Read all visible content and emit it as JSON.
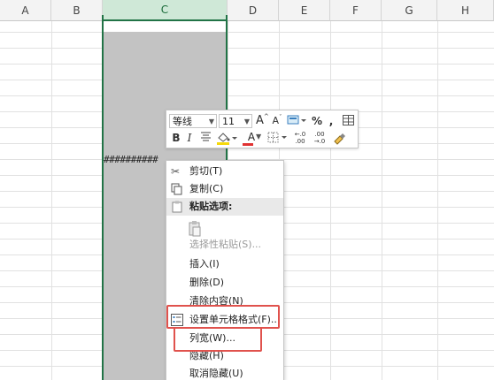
{
  "columns": [
    "A",
    "B",
    "C",
    "D",
    "E",
    "F",
    "G",
    "H"
  ],
  "selected_column": "C",
  "cell_overflow_text": "##########",
  "mini_toolbar": {
    "font_name": "等线",
    "font_size": "11",
    "increase_font": "A",
    "decrease_font": "A",
    "percent": "%",
    "comma": ",",
    "bold": "B",
    "italic": "I",
    "font_color": "A",
    "dec_increase": "←.0",
    "dec_decrease": ".00",
    "dec_increase_sub": ".00",
    "dec_decrease_sub": "→.0"
  },
  "context_menu": {
    "cut": "剪切(T)",
    "copy": "复制(C)",
    "paste_options": "粘贴选项:",
    "paste_special": "选择性粘贴(S)...",
    "insert": "插入(I)",
    "delete": "删除(D)",
    "clear": "清除内容(N)",
    "format_cells": "设置单元格格式(F)...",
    "column_width": "列宽(W)...",
    "hide": "隐藏(H)",
    "unhide": "取消隐藏(U)"
  },
  "colors": {
    "selection_border": "#217346",
    "selected_fill": "#c3c3c3",
    "highlight": "#e0524d",
    "font_color_red": "#e03131",
    "fill_color_yellow": "#f5d90a"
  }
}
